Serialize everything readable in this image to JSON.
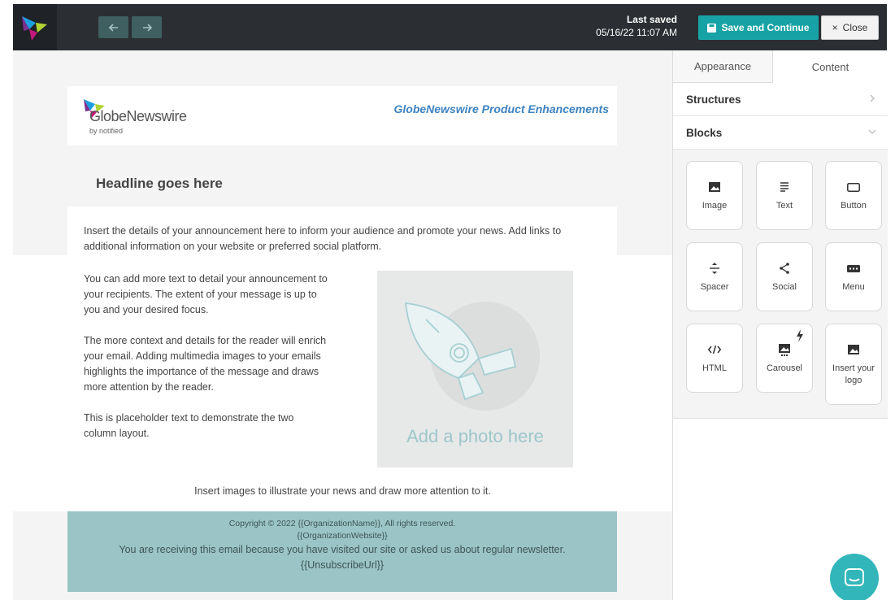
{
  "header": {
    "last_saved_label": "Last saved",
    "last_saved_time": "05/16/22 11:07 AM",
    "save_label": "Save and Continue",
    "close_label": "Close",
    "close_glyph": "×"
  },
  "email": {
    "logo_name": "GlobeNewswire",
    "logo_sub": "by notified",
    "title": "GlobeNewswire Product Enhancements",
    "headline": "Headline goes here",
    "intro": "Insert the details of your announcement here to inform your audience and promote your news. Add links to additional information on your website or preferred social platform.",
    "col_p1": "You can add more text to detail your announcement to your recipients. The extent of your message is up to you and your desired focus.",
    "col_p2": "The more context and details for the reader will enrich your email. Adding multimedia images to your emails highlights the importance of the message and draws more attention by the reader.",
    "col_p3": "This is placeholder text to demonstrate the two column layout.",
    "photo_label": "Add a photo here",
    "caption": "Insert images to illustrate your news and draw more attention to it.",
    "footer_line1": "Copyright © 2022 {{OrganizationName}}, All rights reserved.",
    "footer_line2": "{{OrganizationWebsite}}",
    "footer_line3": "You are receiving this email because you have visited our site or asked us about regular newsletter.",
    "footer_line4": "{{UnsubscribeUrl}}"
  },
  "panel": {
    "tabs": [
      "Appearance",
      "Content"
    ],
    "structures_label": "Structures",
    "blocks_label": "Blocks",
    "blocks": [
      {
        "label": "Image",
        "icon": "image-icon"
      },
      {
        "label": "Text",
        "icon": "text-icon"
      },
      {
        "label": "Button",
        "icon": "button-icon"
      },
      {
        "label": "Spacer",
        "icon": "spacer-icon"
      },
      {
        "label": "Social",
        "icon": "share-icon"
      },
      {
        "label": "Menu",
        "icon": "menu-icon"
      },
      {
        "label": "HTML",
        "icon": "code-icon"
      },
      {
        "label": "Carousel",
        "icon": "carousel-icon"
      },
      {
        "label": "Insert your logo",
        "icon": "logo-image-icon"
      }
    ]
  },
  "colors": {
    "topbar": "#2b2f33",
    "accent": "#17a2a5",
    "footer": "#9ac4c6",
    "title_blue": "#3d83c1"
  }
}
